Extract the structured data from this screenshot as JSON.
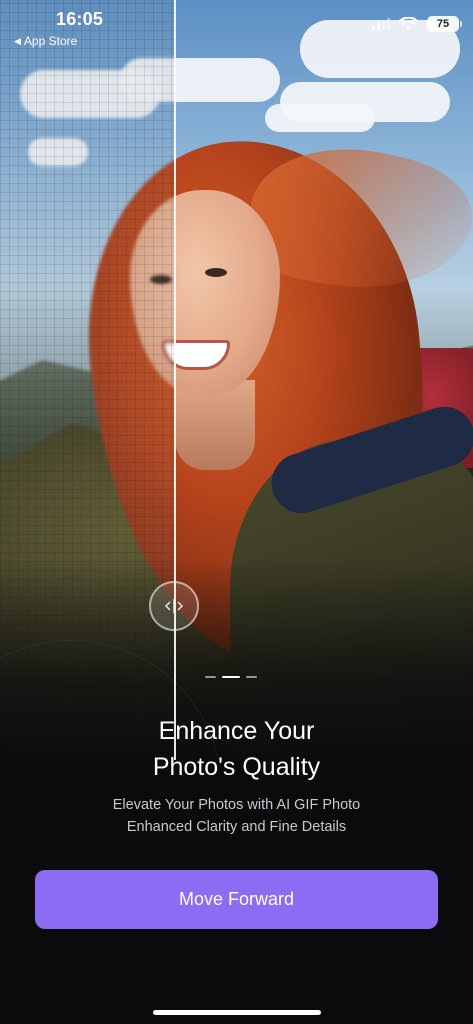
{
  "status_bar": {
    "time": "16:05",
    "back_label": "App Store",
    "battery": "75"
  },
  "comparison": {
    "handle_icon": "split-arrows-icon"
  },
  "pager": {
    "count": 3,
    "active_index": 1
  },
  "onboarding": {
    "title_line1": "Enhance Your",
    "title_line2": "Photo's Quality",
    "subtitle_line1": "Elevate Your Photos with AI GIF Photo",
    "subtitle_line2": "Enhanced Clarity and Fine Details"
  },
  "cta": {
    "label": "Move Forward",
    "color": "#8c6cf2"
  }
}
